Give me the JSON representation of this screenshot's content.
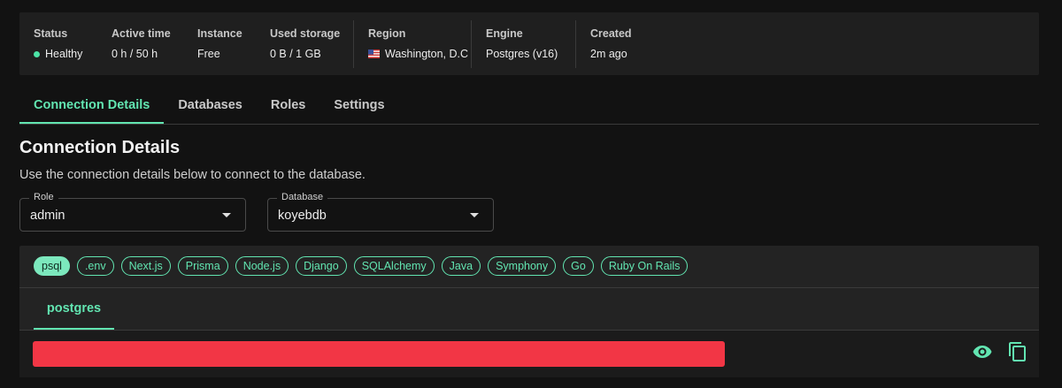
{
  "stats": [
    {
      "label": "Status",
      "value": "Healthy"
    },
    {
      "label": "Active time",
      "value": "0 h / 50 h"
    },
    {
      "label": "Instance",
      "value": "Free"
    },
    {
      "label": "Used storage",
      "value": "0 B / 1 GB"
    },
    {
      "label": "Region",
      "value": "Washington, D.C"
    },
    {
      "label": "Engine",
      "value": "Postgres (v16)"
    },
    {
      "label": "Created",
      "value": "2m ago"
    }
  ],
  "status_color": "#4ce3a6",
  "accent_color": "#62e5b1",
  "tabs": [
    "Connection Details",
    "Databases",
    "Roles",
    "Settings"
  ],
  "section": {
    "title": "Connection Details",
    "description": "Use the connection details below to connect to the database."
  },
  "role_select": {
    "label": "Role",
    "value": "admin"
  },
  "database_select": {
    "label": "Database",
    "value": "koyebdb"
  },
  "formats": [
    "psql",
    ".env",
    "Next.js",
    "Prisma",
    "Node.js",
    "Django",
    "SQLAlchemy",
    "Java",
    "Symphony",
    "Go",
    "Ruby On Rails"
  ],
  "connection": {
    "subtab": "postgres"
  },
  "icons": {
    "reveal": "eye-icon",
    "copy": "copy-icon",
    "region_flag": "us-flag-icon"
  },
  "redaction_color": "#f23645"
}
